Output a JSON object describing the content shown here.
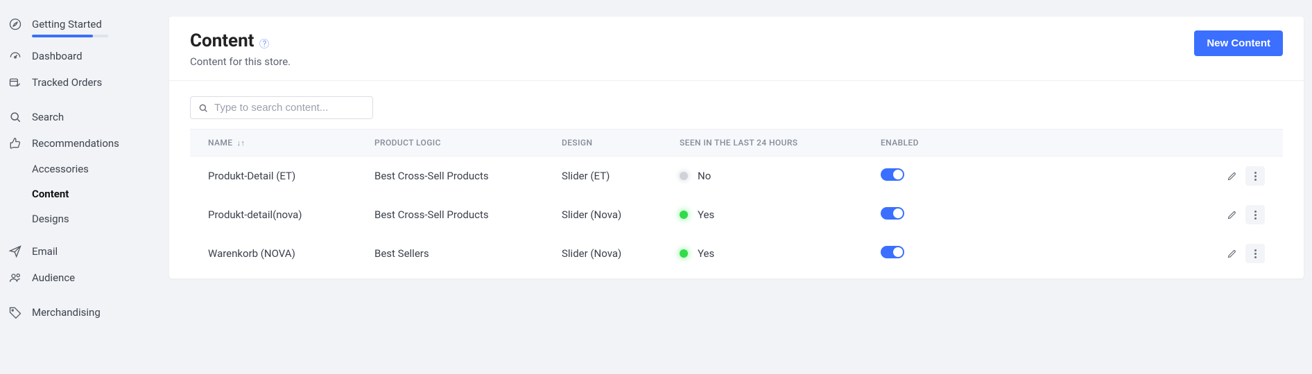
{
  "sidebar": {
    "getting_started": "Getting Started",
    "progress_percent": 80,
    "dashboard": "Dashboard",
    "tracked_orders": "Tracked Orders",
    "search": "Search",
    "recommendations": "Recommendations",
    "accessories": "Accessories",
    "content": "Content",
    "designs": "Designs",
    "email": "Email",
    "audience": "Audience",
    "merchandising": "Merchandising"
  },
  "header": {
    "title": "Content",
    "subtitle": "Content for this store.",
    "new_button": "New Content"
  },
  "search": {
    "placeholder": "Type to search content..."
  },
  "table": {
    "columns": {
      "name": "NAME",
      "logic": "PRODUCT LOGIC",
      "design": "DESIGN",
      "seen": "SEEN IN THE LAST 24 HOURS",
      "enabled": "ENABLED"
    },
    "rows": [
      {
        "name": "Produkt-Detail (ET)",
        "logic": "Best Cross-Sell Products",
        "design": "Slider (ET)",
        "seen_status": "gray",
        "seen_label": "No",
        "enabled": true
      },
      {
        "name": "Produkt-detail(nova)",
        "logic": "Best Cross-Sell Products",
        "design": "Slider (Nova)",
        "seen_status": "green",
        "seen_label": "Yes",
        "enabled": true
      },
      {
        "name": "Warenkorb (NOVA)",
        "logic": "Best Sellers",
        "design": "Slider (Nova)",
        "seen_status": "green",
        "seen_label": "Yes",
        "enabled": true
      }
    ]
  }
}
